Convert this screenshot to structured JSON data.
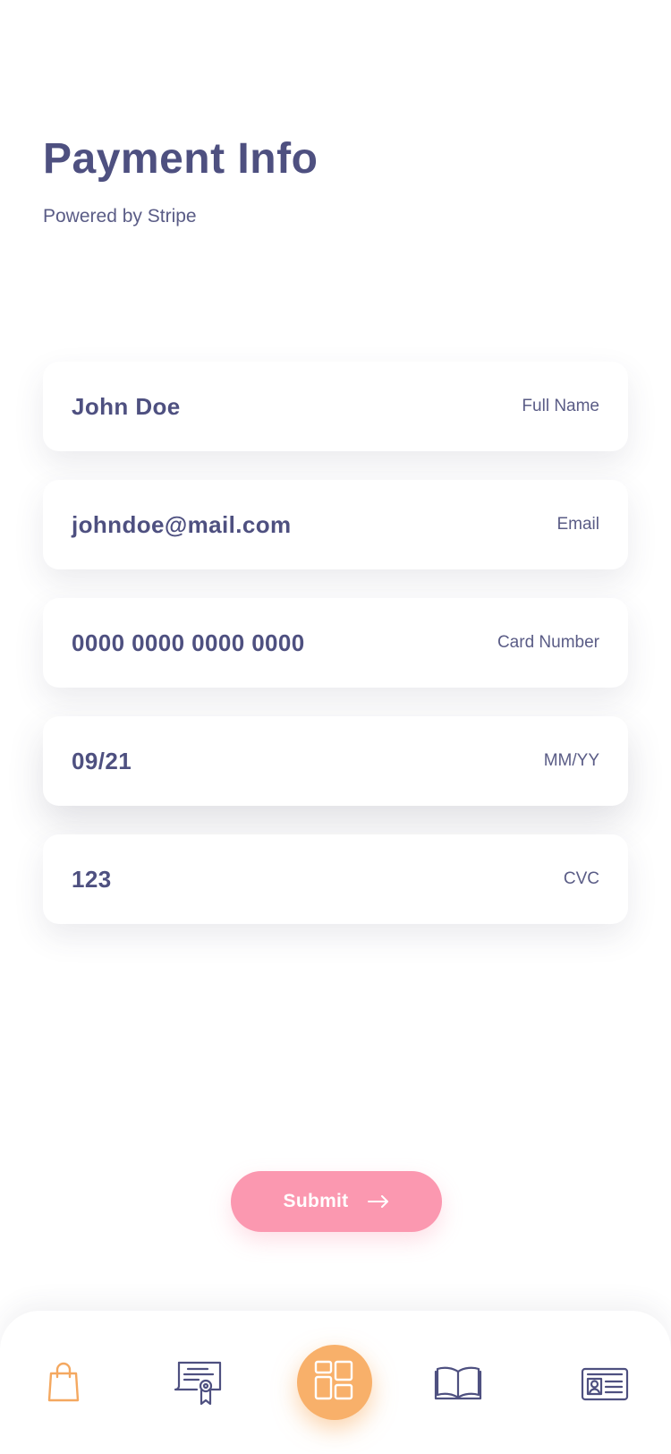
{
  "header": {
    "title": "Payment Info",
    "subtitle": "Powered by Stripe"
  },
  "form": {
    "fields": [
      {
        "value": "John Doe",
        "label": "Full Name"
      },
      {
        "value": "johndoe@mail.com",
        "label": "Email"
      },
      {
        "value": "0000 0000 0000 0000",
        "label": "Card Number"
      },
      {
        "value": "09/21",
        "label": "MM/YY"
      },
      {
        "value": "123",
        "label": "CVC"
      }
    ],
    "submit_label": "Submit"
  },
  "tabbar": {
    "active_tab": "dashboard",
    "tabs": [
      {
        "icon": "shopping-bag-icon"
      },
      {
        "icon": "certificate-icon"
      },
      {
        "icon": "dashboard-grid-icon"
      },
      {
        "icon": "book-icon"
      },
      {
        "icon": "id-card-icon"
      }
    ]
  },
  "colors": {
    "primary_text": "#4e5080",
    "submit": "#fb98b0",
    "accent": "#f8b06a"
  }
}
